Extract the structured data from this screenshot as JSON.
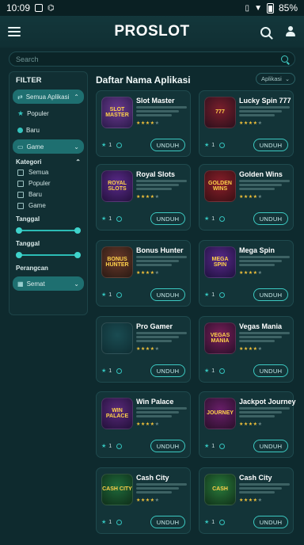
{
  "status_bar": {
    "time": "10:09",
    "battery": "85%"
  },
  "app": {
    "title": "PROSLOT"
  },
  "search": {
    "placeholder": "Search"
  },
  "sidebar": {
    "filter_title": "FILTER",
    "items": [
      {
        "label": "Semua Aplikasi"
      },
      {
        "label": "Populer"
      },
      {
        "label": "Baru"
      },
      {
        "label": "Game"
      }
    ],
    "kategori": {
      "title": "Kategori",
      "options": [
        "Semua",
        "Populer",
        "Baru",
        "Game"
      ]
    },
    "tanggal1": "Tanggal",
    "tanggal2": "Tanggal",
    "peringkat": "Perangcan",
    "semat": "Semat"
  },
  "main": {
    "header": "Daftar Nama Aplikasi",
    "sort_label": "Aplikasi",
    "download_label": "UNDUH",
    "apps": [
      {
        "name": "Slot Master",
        "thumb_text": "SLOT MASTER",
        "count": "1",
        "rating": 4,
        "colors": [
          "#6b3a8f",
          "#2a1a4a"
        ]
      },
      {
        "name": "Lucky Spin 777",
        "thumb_text": "777",
        "count": "1",
        "rating": 4,
        "colors": [
          "#7a1f2c",
          "#2b0f1c"
        ]
      },
      {
        "name": "Royal Slots",
        "thumb_text": "ROYAL SLOTS",
        "count": "1",
        "rating": 4,
        "colors": [
          "#5a2a8a",
          "#24113d"
        ]
      },
      {
        "name": "Golden Wins",
        "thumb_text": "GOLDEN WINS",
        "count": "1",
        "rating": 4,
        "colors": [
          "#8a1f2a",
          "#3a0f14"
        ]
      },
      {
        "name": "Bonus Hunter",
        "thumb_text": "BONUS HUNTER",
        "count": "1",
        "rating": 4,
        "colors": [
          "#6a3a2a",
          "#2a1a14"
        ]
      },
      {
        "name": "Mega Spin",
        "thumb_text": "MEGA SPIN",
        "count": "1",
        "rating": 4,
        "colors": [
          "#5a2a8a",
          "#1f1140"
        ]
      },
      {
        "name": "Pro Gamer",
        "thumb_text": "",
        "count": "1",
        "rating": 4,
        "colors": [
          "#1a4c52",
          "#0f2e33"
        ]
      },
      {
        "name": "Vegas Mania",
        "thumb_text": "VEGAS MANIA",
        "count": "1",
        "rating": 4,
        "colors": [
          "#7a1f5a",
          "#2a0f2a"
        ]
      },
      {
        "name": "Win Palace",
        "thumb_text": "WIN PALACE",
        "count": "1",
        "rating": 4,
        "colors": [
          "#5a2a7a",
          "#22103a"
        ]
      },
      {
        "name": "Jackpot Journey",
        "thumb_text": "JOURNEY",
        "count": "1",
        "rating": 4,
        "colors": [
          "#6a1f6a",
          "#2a0f2a"
        ]
      },
      {
        "name": "Cash City",
        "thumb_text": "CASH CITY",
        "count": "1",
        "rating": 4,
        "colors": [
          "#1f6a3a",
          "#0f2e1a"
        ]
      },
      {
        "name": "Cash City",
        "thumb_text": "CASH",
        "count": "1",
        "rating": 4,
        "colors": [
          "#2a7a3a",
          "#10301a"
        ]
      }
    ]
  }
}
